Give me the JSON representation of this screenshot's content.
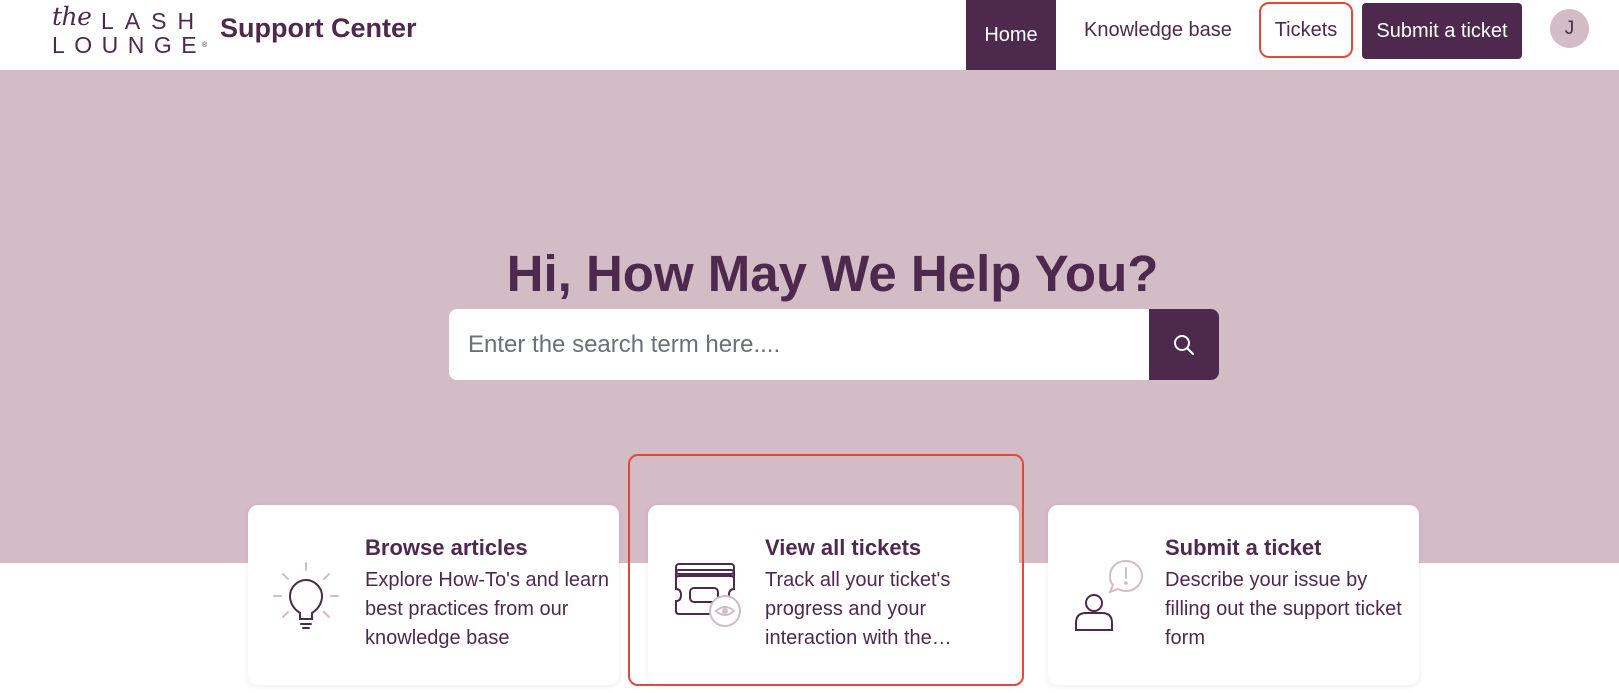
{
  "header": {
    "logo": {
      "line1_script": "the",
      "line1": "LASH",
      "line2": "LOUNGE",
      "mark": "®"
    },
    "site_title": "Support Center",
    "nav": {
      "home": "Home",
      "knowledge_base": "Knowledge base",
      "tickets": "Tickets",
      "submit_ticket": "Submit a ticket"
    },
    "avatar_initial": "J"
  },
  "hero": {
    "title": "Hi, How May We Help You?",
    "search": {
      "placeholder": "Enter the search term here....",
      "value": ""
    }
  },
  "cards": [
    {
      "title": "Browse articles",
      "description": "Explore How-To's and learn best practices from our knowledge base",
      "icon": "lightbulb-icon"
    },
    {
      "title": "View all tickets",
      "description": "Track all your ticket's progress and your interaction with the…",
      "icon": "tickets-eye-icon"
    },
    {
      "title": "Submit a ticket",
      "description": "Describe your issue by filling out the support ticket form",
      "icon": "person-alert-icon"
    }
  ],
  "colors": {
    "brand": "#4d2a4d",
    "hero_bg": "#d4bcc7",
    "highlight": "#e04a3a",
    "placeholder": "#6b6f77"
  }
}
